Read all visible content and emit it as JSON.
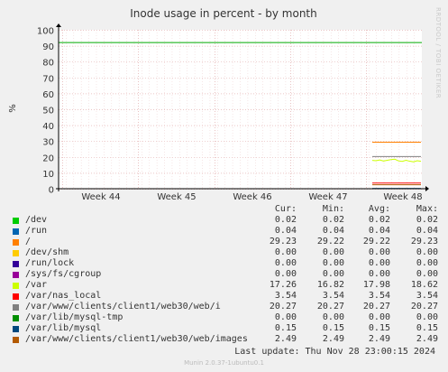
{
  "chart_data": {
    "type": "line",
    "title": "Inode usage in percent - by month",
    "ylabel": "%",
    "ylim": [
      0,
      100
    ],
    "yticks": [
      0,
      10,
      20,
      30,
      40,
      50,
      60,
      70,
      80,
      90,
      100
    ],
    "xticks": [
      "Week 44",
      "Week 45",
      "Week 46",
      "Week 47",
      "Week 48"
    ],
    "grid": true,
    "columns": [
      "Cur:",
      "Min:",
      "Avg:",
      "Max:"
    ],
    "series": [
      {
        "name": "/dev",
        "color": "#00cc00",
        "cur": "0.02",
        "min": "0.02",
        "avg": "0.02",
        "max": "0.02"
      },
      {
        "name": "/run",
        "color": "#0066b3",
        "cur": "0.04",
        "min": "0.04",
        "avg": "0.04",
        "max": "0.04"
      },
      {
        "name": "/",
        "color": "#ff8000",
        "cur": "29.23",
        "min": "29.22",
        "avg": "29.22",
        "max": "29.23"
      },
      {
        "name": "/dev/shm",
        "color": "#ffcc00",
        "cur": "0.00",
        "min": "0.00",
        "avg": "0.00",
        "max": "0.00"
      },
      {
        "name": "/run/lock",
        "color": "#330099",
        "cur": "0.00",
        "min": "0.00",
        "avg": "0.00",
        "max": "0.00"
      },
      {
        "name": "/sys/fs/cgroup",
        "color": "#990099",
        "cur": "0.00",
        "min": "0.00",
        "avg": "0.00",
        "max": "0.00"
      },
      {
        "name": "/var",
        "color": "#ccff00",
        "cur": "17.26",
        "min": "16.82",
        "avg": "17.98",
        "max": "18.62"
      },
      {
        "name": "/var/nas_local",
        "color": "#ff0000",
        "cur": "3.54",
        "min": "3.54",
        "avg": "3.54",
        "max": "3.54"
      },
      {
        "name": "/var/www/clients/client1/web30/web/i",
        "color": "#808080",
        "cur": "20.27",
        "min": "20.27",
        "avg": "20.27",
        "max": "20.27"
      },
      {
        "name": "/var/lib/mysql-tmp",
        "color": "#008f00",
        "cur": "0.00",
        "min": "0.00",
        "avg": "0.00",
        "max": "0.00"
      },
      {
        "name": "/var/lib/mysql",
        "color": "#00487d",
        "cur": "0.15",
        "min": "0.15",
        "avg": "0.15",
        "max": "0.15"
      },
      {
        "name": "/var/www/clients/client1/web30/web/images",
        "color": "#b35a00",
        "cur": "2.49",
        "min": "2.49",
        "avg": "2.49",
        "max": "2.49"
      }
    ],
    "reference_line": {
      "value": 92,
      "color": "#00aa00"
    },
    "var_points": [
      17.8,
      17.6,
      18.1,
      17.4,
      17.9,
      18.3,
      18.6,
      17.5,
      17.2,
      17.9,
      17.3,
      16.9,
      17.6,
      17.26
    ]
  },
  "footer": {
    "last_update": "Last update: Thu Nov 28 23:00:15 2024",
    "version": "Munin 2.0.37-1ubuntu0.1",
    "watermark": "RRDTOOL / TOBI OETIKER"
  }
}
